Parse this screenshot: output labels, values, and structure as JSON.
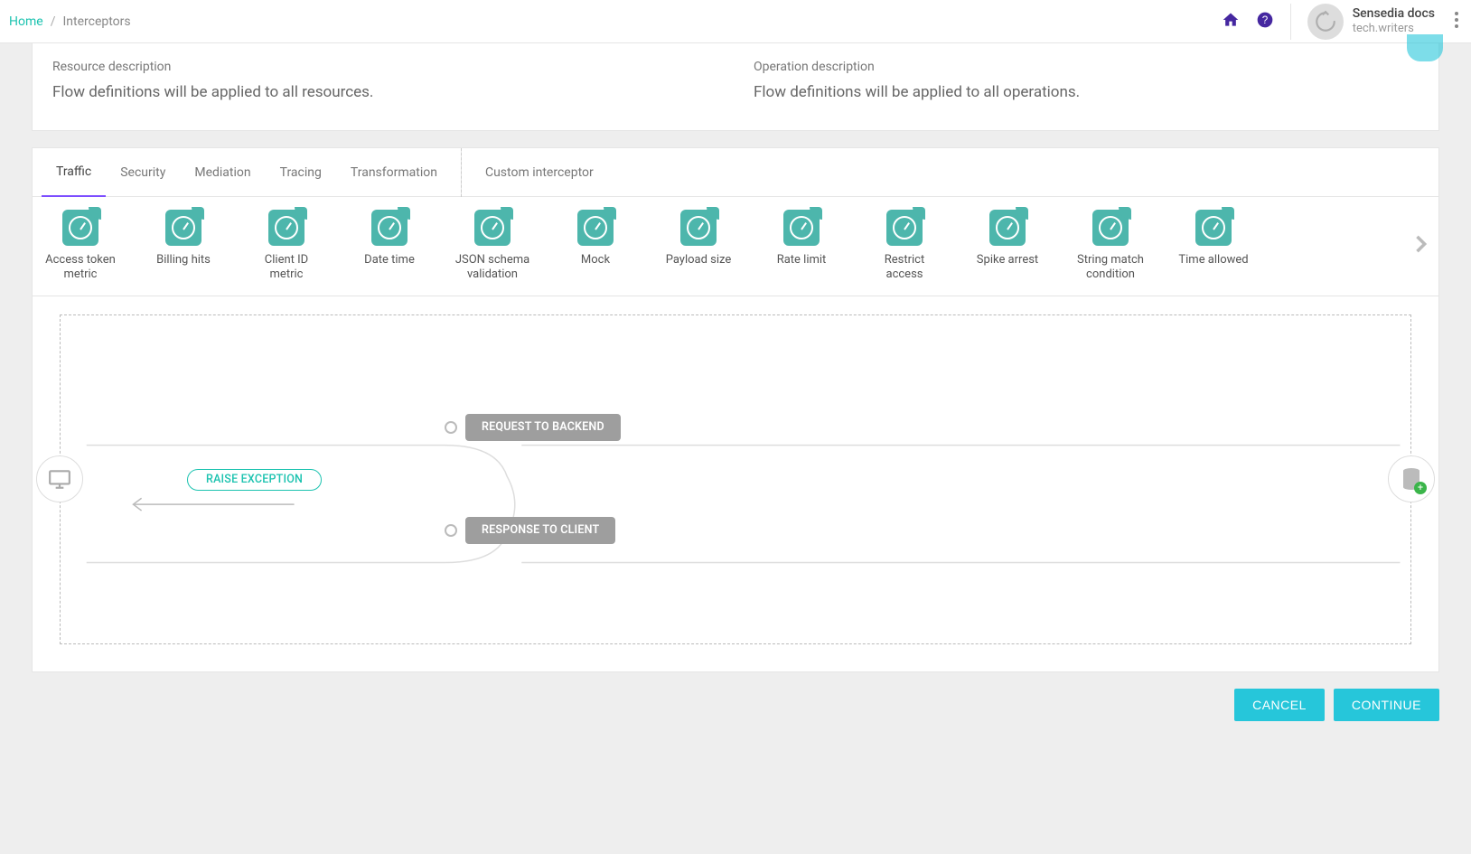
{
  "breadcrumb": {
    "home": "Home",
    "current": "Interceptors"
  },
  "user": {
    "name": "Sensedia docs",
    "role": "tech.writers"
  },
  "descriptions": {
    "resource_label": "Resource description",
    "resource_value": "Flow definitions will be applied to all resources.",
    "operation_label": "Operation description",
    "operation_value": "Flow definitions will be applied to all operations."
  },
  "tabs": {
    "traffic": "Traffic",
    "security": "Security",
    "mediation": "Mediation",
    "tracing": "Tracing",
    "transformation": "Transformation",
    "custom": "Custom interceptor"
  },
  "interceptors": [
    "Access token\nmetric",
    "Billing hits",
    "Client ID metric",
    "Date time",
    "JSON schema\nvalidation",
    "Mock",
    "Payload size",
    "Rate limit",
    "Restrict access",
    "Spike arrest",
    "String match\ncondition",
    "Time allowed"
  ],
  "flow": {
    "request_label": "REQUEST TO BACKEND",
    "response_label": "RESPONSE TO CLIENT",
    "raise_label": "RAISE EXCEPTION"
  },
  "actions": {
    "cancel": "CANCEL",
    "continue": "CONTINUE"
  }
}
